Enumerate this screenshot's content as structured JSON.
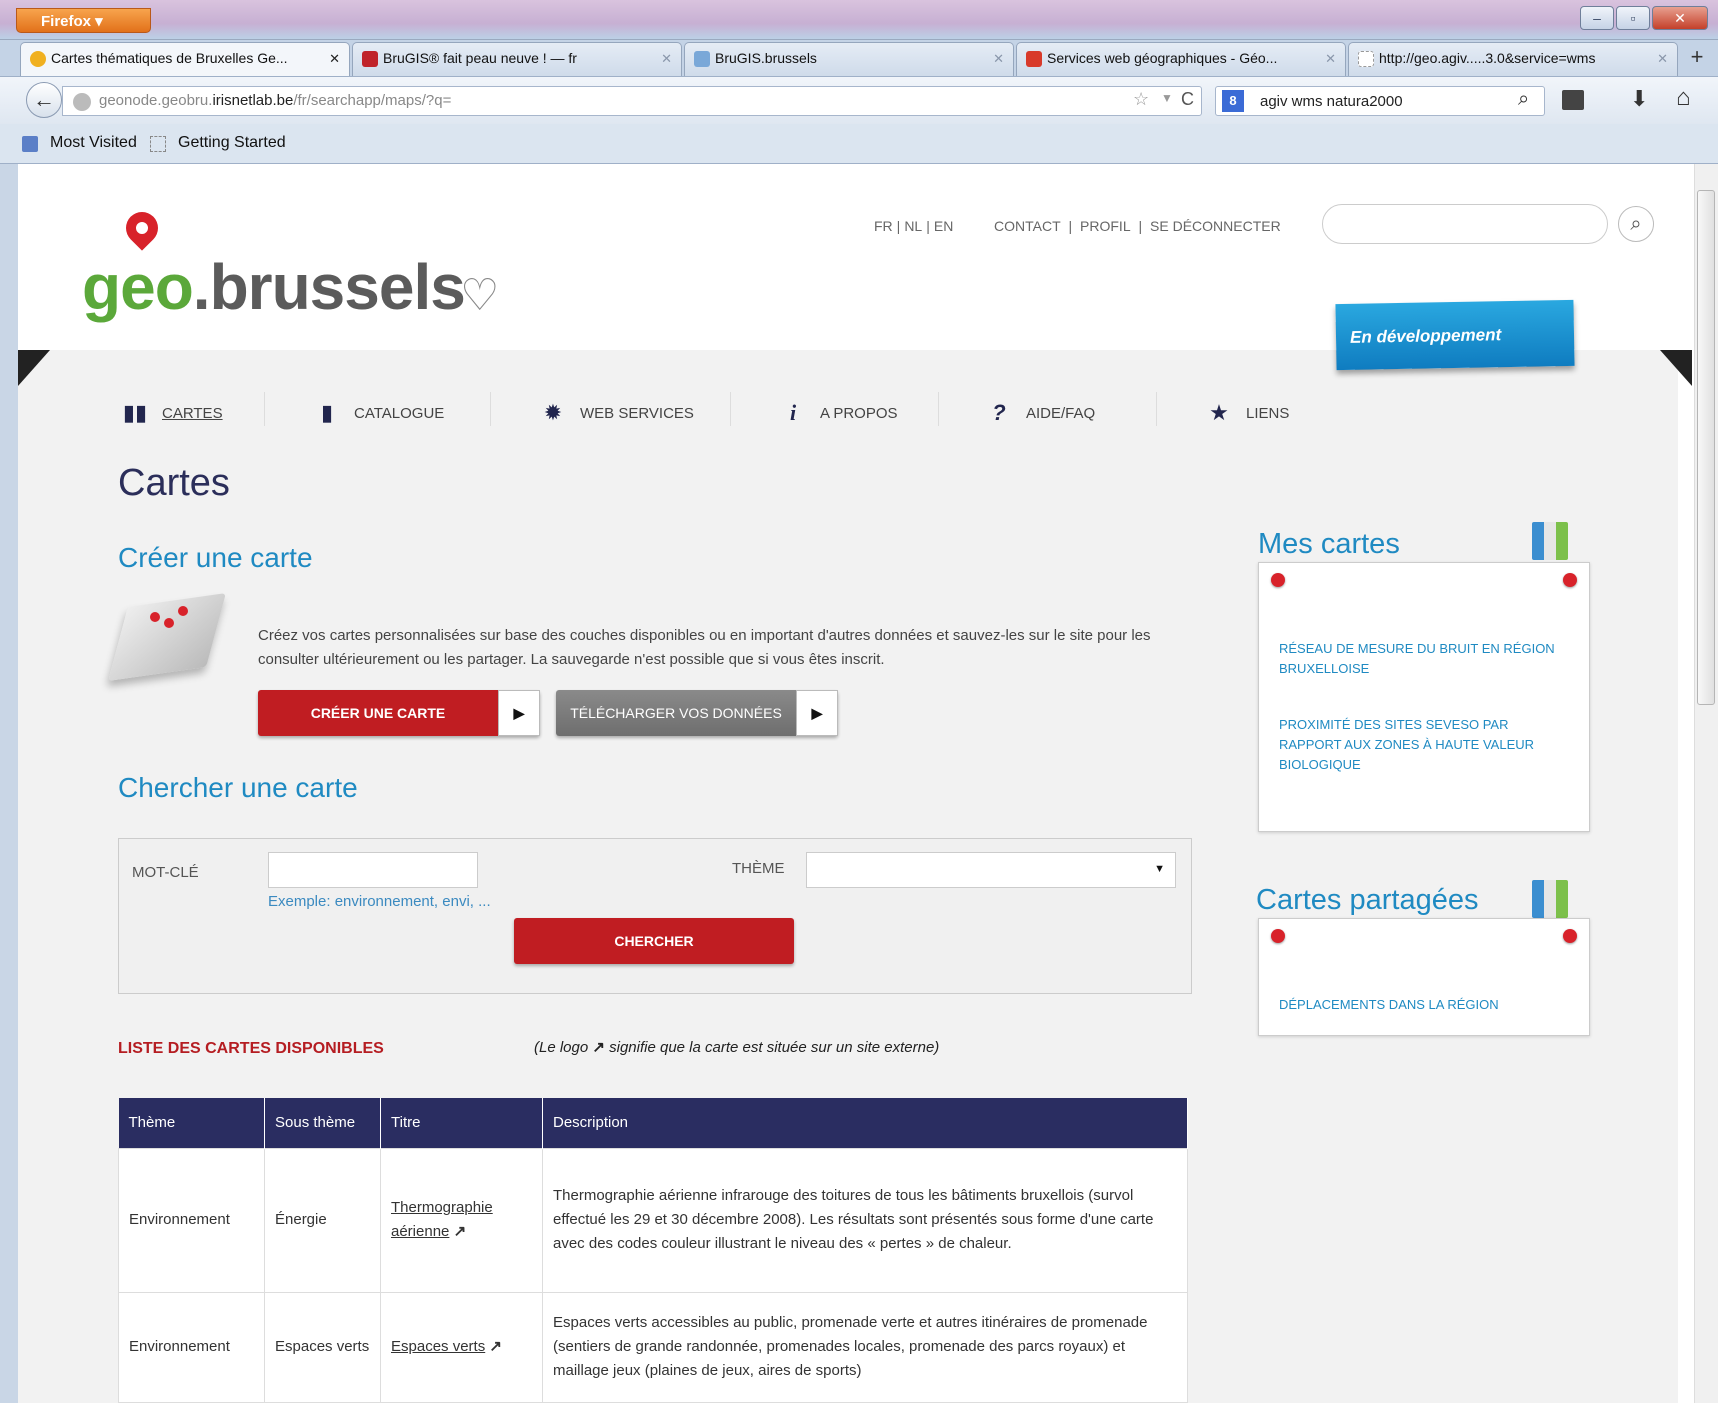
{
  "browser": {
    "menu_button": "Firefox ▾",
    "tabs": [
      {
        "label": "Cartes thématiques de Bruxelles Ge...",
        "icon": "geonode-icon"
      },
      {
        "label": "BruGIS® fait peau neuve ! — fr",
        "icon": "brugis-icon"
      },
      {
        "label": "BruGIS.brussels",
        "icon": "map-icon"
      },
      {
        "label": "Services web géographiques - Géo...",
        "icon": "wallonie-icon"
      },
      {
        "label": "http://geo.agiv.....3.0&service=wms",
        "icon": "page-icon"
      }
    ],
    "new_tab": "+",
    "url_prefix": "geonode.geobru.",
    "url_domain": "irisnetlab.be",
    "url_suffix": "/fr/searchapp/maps/?q=",
    "search_value": "agiv wms natura2000",
    "bookmarks": [
      "Most Visited",
      "Getting Started"
    ]
  },
  "header": {
    "logo_geo": "geo",
    "logo_rest": ".brussels",
    "languages": [
      "FR",
      "NL",
      "EN"
    ],
    "links": [
      "CONTACT",
      "PROFIL",
      "SE DÉCONNECTER"
    ],
    "badge": "En développement"
  },
  "menu": [
    {
      "label": "CARTES",
      "icon": "map-book-icon",
      "active": true
    },
    {
      "label": "CATALOGUE",
      "icon": "book-icon",
      "active": false
    },
    {
      "label": "WEB SERVICES",
      "icon": "gear-icon",
      "active": false
    },
    {
      "label": "A PROPOS",
      "icon": "info-icon",
      "active": false
    },
    {
      "label": "AIDE/FAQ",
      "icon": "question-icon",
      "active": false
    },
    {
      "label": "LIENS",
      "icon": "star-icon",
      "active": false
    }
  ],
  "main": {
    "title": "Cartes",
    "create_heading": "Créer une carte",
    "create_text": "Créez vos cartes personnalisées sur base des couches disponibles ou en important d'autres données et sauvez-les sur le site pour les consulter ultérieurement ou les partager. La sauvegarde n'est possible que si vous êtes inscrit.",
    "create_button": "CRÉER UNE CARTE",
    "upload_button": "TÉLÉCHARGER VOS DONNÉES",
    "search_heading": "Chercher une carte",
    "keyword_label": "MOT-CLÉ",
    "keyword_value": "",
    "keyword_example": "Exemple: environnement, envi, ...",
    "theme_label": "THÈME",
    "theme_value": "",
    "search_button": "CHERCHER",
    "list_title": "LISTE DES CARTES DISPONIBLES",
    "list_note_pre": "(Le logo ",
    "list_note_post": " signifie que la carte est située sur un site externe)"
  },
  "table": {
    "headers": [
      "Thème",
      "Sous thème",
      "Titre",
      "Description"
    ],
    "rows": [
      {
        "theme": "Environnement",
        "subtheme": "Énergie",
        "title": "Thermographie aérienne",
        "description": "Thermographie aérienne infrarouge des toitures de tous les bâtiments bruxellois (survol effectué les 29 et 30 décembre 2008). Les résultats sont présentés sous forme d'une carte avec des codes couleur illustrant le niveau des « pertes » de chaleur."
      },
      {
        "theme": "Environnement",
        "subtheme": "Espaces verts",
        "title": "Espaces verts",
        "description": "Espaces verts accessibles au public, promenade verte et autres itinéraires de promenade (sentiers de grande randonnée, promenades locales, promenade des parcs royaux) et maillage jeux (plaines de jeux, aires de sports)"
      }
    ]
  },
  "sidebar": {
    "my_maps_title": "Mes cartes",
    "my_maps": [
      "Réseau de mesure du bruit en région bruxelloise",
      "Proximité des sites Seveso par rapport aux zones à haute valeur biologique"
    ],
    "shared_title": "Cartes partagées",
    "shared_maps": [
      "Déplacements dans la région"
    ]
  },
  "colors": {
    "accent_blue": "#1f8ac2",
    "brand_red": "#c01d22",
    "navy": "#2a2d61",
    "logo_green": "#5ba83a"
  }
}
